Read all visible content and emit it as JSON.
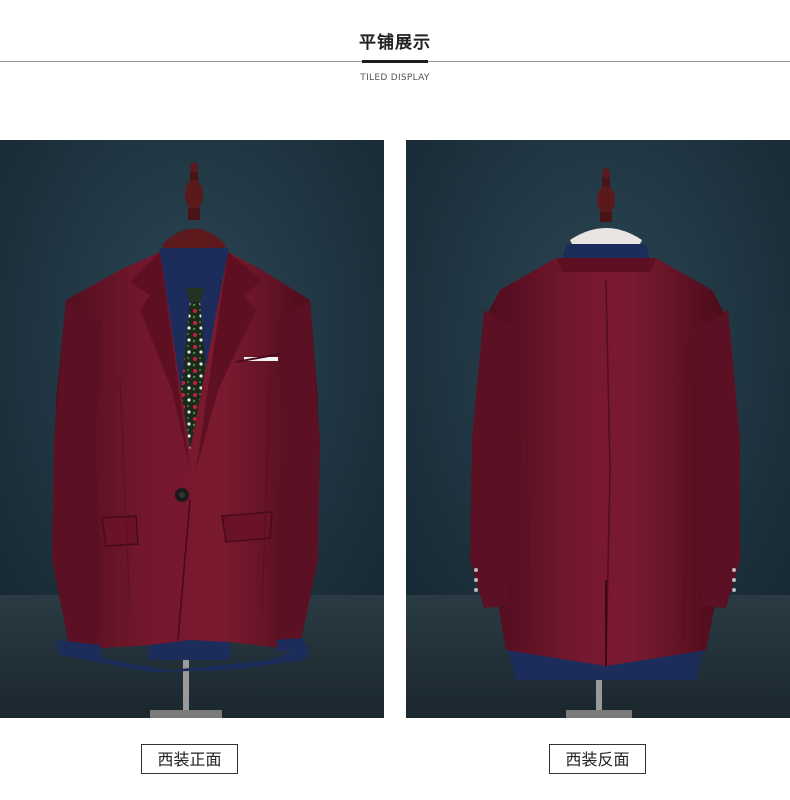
{
  "header": {
    "title": "平铺展示",
    "subtitle": "TILED DISPLAY"
  },
  "views": [
    {
      "caption": "西装正面"
    },
    {
      "caption": "西装反面"
    }
  ],
  "colors": {
    "background_wall": "#1f3340",
    "jacket": "#6e1428",
    "shirt": "#1c2d5c",
    "mannequin": "#5a1a1c",
    "tie_base": "#1a2a1a",
    "tie_flowers": "#c8203a"
  }
}
